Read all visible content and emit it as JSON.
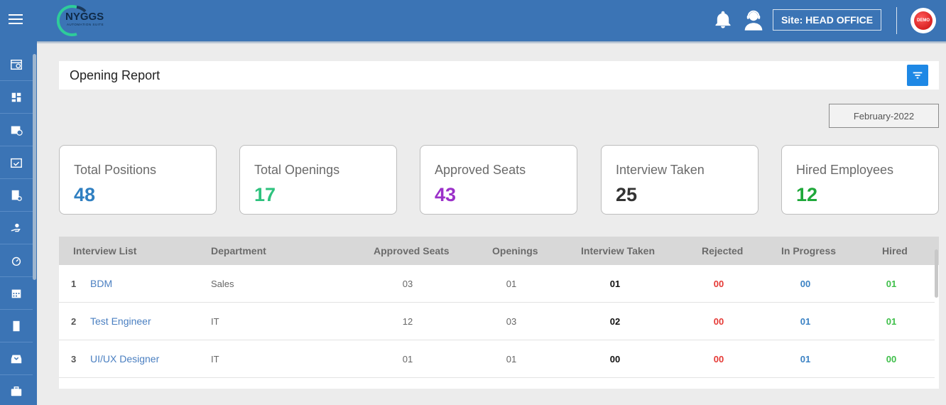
{
  "header": {
    "logo_text": "NYGGS",
    "logo_subtext": "AUTOMATION SUITE",
    "site_label": "Site: HEAD OFFICE",
    "avatar_text": "DEMO",
    "icons": [
      "menu-icon",
      "bell-icon",
      "support-agent-icon"
    ]
  },
  "sidebar": {
    "items": [
      {
        "icon": "calendar-clock-icon"
      },
      {
        "icon": "dashboard-icon"
      },
      {
        "icon": "calendar-add-icon"
      },
      {
        "icon": "calendar-check-icon"
      },
      {
        "icon": "document-settings-icon"
      },
      {
        "icon": "hand-user-icon"
      },
      {
        "icon": "timer-icon"
      },
      {
        "icon": "calendar-grid-icon"
      },
      {
        "icon": "page-icon"
      },
      {
        "icon": "inbox-download-icon"
      },
      {
        "icon": "briefcase-icon"
      }
    ]
  },
  "page": {
    "title": "Opening Report",
    "month": "February-2022"
  },
  "cards": [
    {
      "label": "Total Positions",
      "value": "48",
      "color": "#2f7fc1"
    },
    {
      "label": "Total Openings",
      "value": "17",
      "color": "#2ec27e"
    },
    {
      "label": "Approved Seats",
      "value": "43",
      "color": "#9b30c9"
    },
    {
      "label": "Interview Taken",
      "value": "25",
      "color": "#333333"
    },
    {
      "label": "Hired Employees",
      "value": "12",
      "color": "#1fa83a"
    }
  ],
  "table": {
    "headers": [
      "Interview List",
      "Department",
      "Approved Seats",
      "Openings",
      "Interview Taken",
      "Rejected",
      "In Progress",
      "Hired"
    ],
    "rows": [
      {
        "index": "1",
        "name": "BDM",
        "department": "Sales",
        "approved": "03",
        "openings": "01",
        "taken": "01",
        "rejected": "00",
        "progress": "00",
        "hired": "01"
      },
      {
        "index": "2",
        "name": "Test Engineer",
        "department": "IT",
        "approved": "12",
        "openings": "03",
        "taken": "02",
        "rejected": "00",
        "progress": "01",
        "hired": "01"
      },
      {
        "index": "3",
        "name": "UI/UX Designer",
        "department": "IT",
        "approved": "01",
        "openings": "01",
        "taken": "00",
        "rejected": "00",
        "progress": "01",
        "hired": "00"
      }
    ]
  },
  "colors": {
    "brand": "#3b74b5",
    "taken": "#111111",
    "rejected": "#e53935",
    "progress": "#3b82c4",
    "hired": "#3fbf4a"
  }
}
